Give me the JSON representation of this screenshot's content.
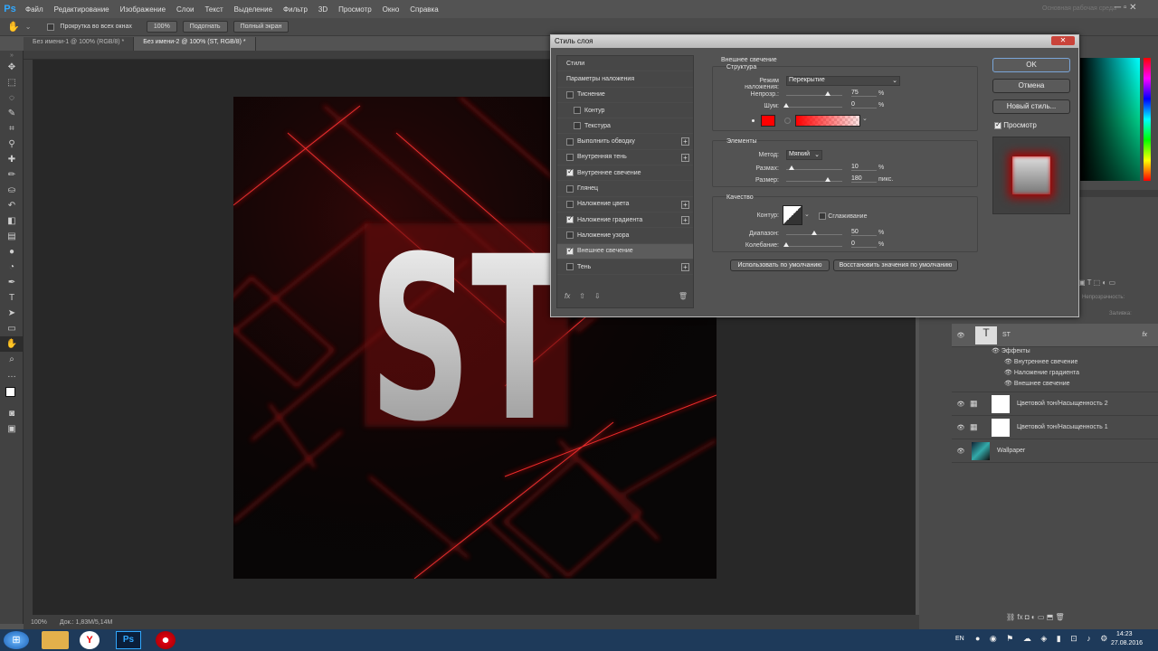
{
  "app": {
    "logo": "Ps",
    "workspace": "Основная рабочая среда"
  },
  "menu": [
    "Файл",
    "Редактирование",
    "Изображение",
    "Слои",
    "Текст",
    "Выделение",
    "Фильтр",
    "3D",
    "Просмотр",
    "Окно",
    "Справка"
  ],
  "options": {
    "scroll_all": "Прокрутка во всех окнах",
    "zoom": "100%",
    "fit": "Подогнать",
    "fullscreen": "Полный экран"
  },
  "tabs": [
    "Без имени-1 @ 100% (RGB/8) *",
    "Без имени-2 @ 100% (ST, RGB/8) *"
  ],
  "status": {
    "zoom": "100%",
    "doc": "Док.: 1,83M/5,14M"
  },
  "canvas_text": "ST",
  "dialog": {
    "title": "Стиль слоя",
    "close": "✕",
    "styles": [
      {
        "label": "Стили",
        "check": null,
        "plus": false,
        "indent": 0
      },
      {
        "label": "Параметры наложения",
        "check": null,
        "plus": false,
        "indent": 0
      },
      {
        "label": "Тиснение",
        "check": false,
        "plus": false,
        "indent": 0
      },
      {
        "label": "Контур",
        "check": false,
        "plus": false,
        "indent": 1
      },
      {
        "label": "Текстура",
        "check": false,
        "plus": false,
        "indent": 1
      },
      {
        "label": "Выполнить обводку",
        "check": false,
        "plus": true,
        "indent": 0
      },
      {
        "label": "Внутренняя тень",
        "check": false,
        "plus": true,
        "indent": 0
      },
      {
        "label": "Внутреннее свечение",
        "check": true,
        "plus": false,
        "indent": 0
      },
      {
        "label": "Глянец",
        "check": false,
        "plus": false,
        "indent": 0
      },
      {
        "label": "Наложение цвета",
        "check": false,
        "plus": true,
        "indent": 0
      },
      {
        "label": "Наложение градиента",
        "check": true,
        "plus": true,
        "indent": 0
      },
      {
        "label": "Наложение узора",
        "check": false,
        "plus": false,
        "indent": 0
      },
      {
        "label": "Внешнее свечение",
        "check": true,
        "plus": false,
        "indent": 0,
        "selected": true
      },
      {
        "label": "Тень",
        "check": false,
        "plus": true,
        "indent": 0
      }
    ],
    "section_title": "Внешнее свечение",
    "structure": {
      "title": "Структура",
      "blend_label": "Режим наложения:",
      "blend_value": "Перекрытие",
      "opacity_label": "Непрозр.:",
      "opacity": 75,
      "noise_label": "Шум:",
      "noise": 0,
      "unit": "%",
      "glow_color": "#ff0000"
    },
    "elements": {
      "title": "Элементы",
      "method_label": "Метод:",
      "method_value": "Мягкий",
      "spread_label": "Размах:",
      "spread": 10,
      "size_label": "Размер:",
      "size": 180,
      "size_unit": "пикс.",
      "unit": "%"
    },
    "quality": {
      "title": "Качество",
      "contour_label": "Контур:",
      "antialias_label": "Сглаживание",
      "range_label": "Диапазон:",
      "range": 50,
      "jitter_label": "Колебание:",
      "jitter": 0,
      "unit": "%"
    },
    "buttons": {
      "default": "Использовать по умолчанию",
      "reset": "Восстановить значения по умолчанию",
      "ok": "OK",
      "cancel": "Отмена",
      "new_style": "Новый стиль...",
      "preview": "Просмотр"
    }
  },
  "layers": {
    "opacity_label": "Непрозрачность:",
    "fill_label": "Заливка:",
    "items": [
      {
        "name": "ST",
        "type": "text",
        "fx": "fx"
      },
      {
        "name": "Эффекты",
        "type": "effects-header"
      },
      {
        "name": "Внутреннее свечение",
        "type": "effect"
      },
      {
        "name": "Наложение градиента",
        "type": "effect"
      },
      {
        "name": "Внешнее свечение",
        "type": "effect"
      },
      {
        "name": "Цветовой тон/Насыщенность 2",
        "type": "adjust"
      },
      {
        "name": "Цветовой тон/Насыщенность 1",
        "type": "adjust"
      },
      {
        "name": "Wallpaper",
        "type": "image"
      }
    ]
  },
  "taskbar": {
    "lang": "EN",
    "time": "14:23",
    "date": "27.08.2016"
  }
}
